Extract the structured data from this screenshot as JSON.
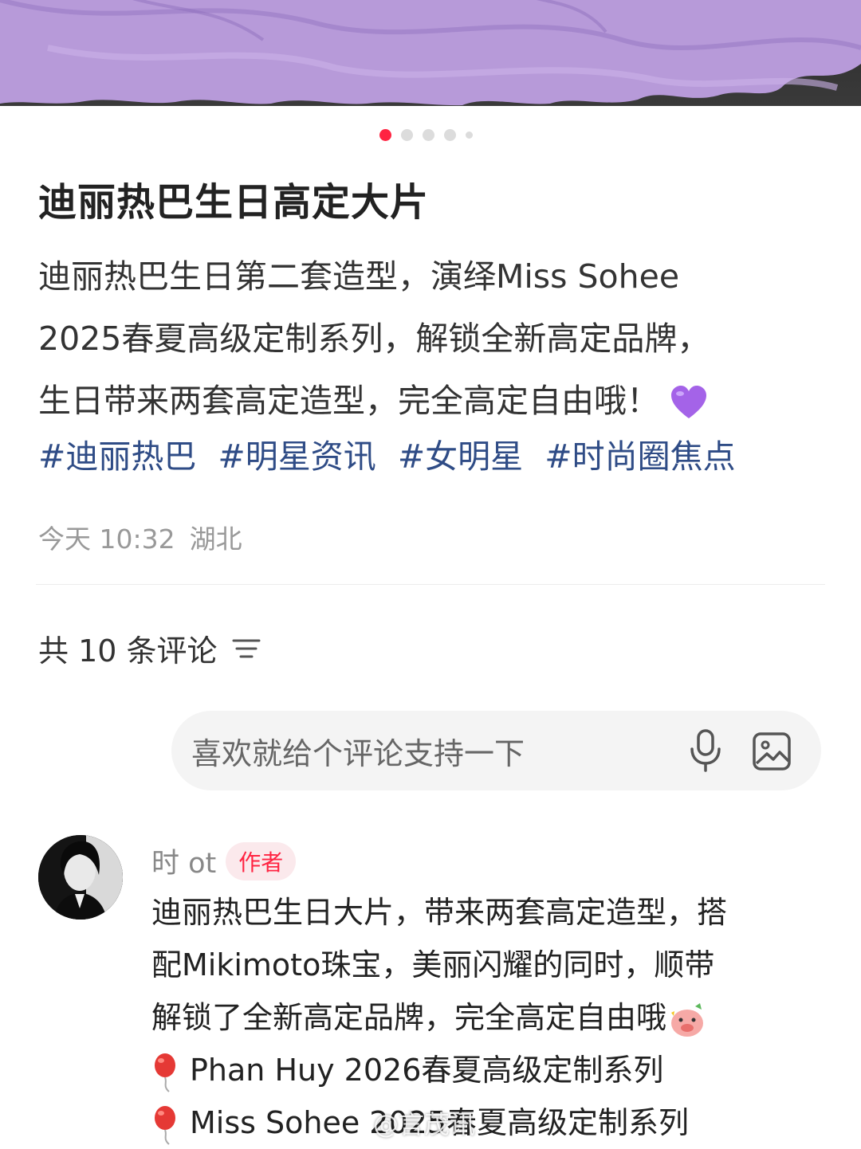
{
  "carousel": {
    "total": 5,
    "active": 0
  },
  "post": {
    "title": "迪丽热巴生日高定大片",
    "description_lines": [
      "迪丽热巴生日第二套造型，演绎Miss Sohee",
      "2025春夏高级定制系列，解锁全新高定品牌，",
      "生日带来两套高定造型，完全高定自由哦！"
    ],
    "emoji": "purple-heart",
    "tags": [
      "#迪丽热巴",
      "#明星资讯",
      "#女明星",
      "#时尚圈焦点"
    ],
    "time": "今天 10:32",
    "location": "湖北"
  },
  "comments": {
    "count_label": "共 10 条评论",
    "input_placeholder": "喜欢就给个评论支持一下",
    "items": [
      {
        "author": "时    ot",
        "badge": "作者",
        "lines": [
          "迪丽热巴生日大片，带来两套高定造型，搭",
          "配Mikimoto珠宝，美丽闪耀的同时，顺带",
          "解锁了全新高定品牌，完全高定自由哦"
        ],
        "list": [
          "Phan Huy 2026春夏高级定制系列",
          "Miss Sohee 2025春夏高级定制系列"
        ]
      }
    ]
  },
  "watermark": "@言茂讯",
  "colors": {
    "accent": "#ff2442",
    "tag": "#2f4c86",
    "meta": "#999999"
  }
}
